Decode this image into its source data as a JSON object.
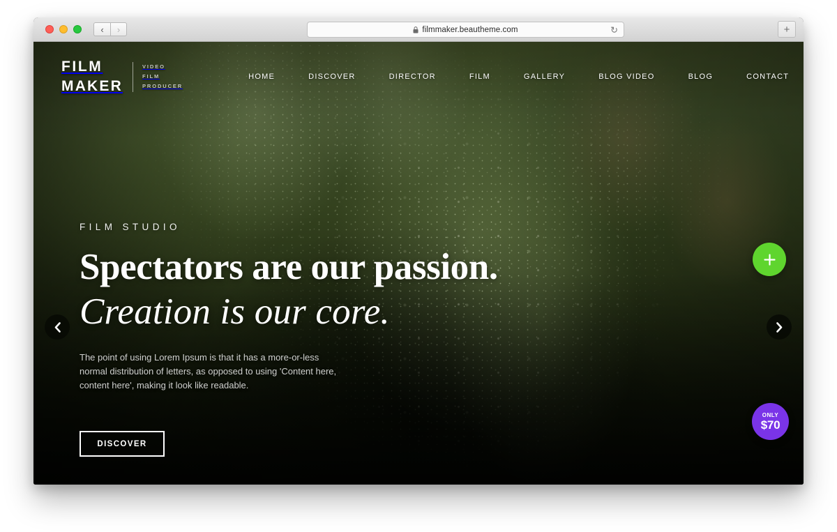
{
  "browser": {
    "traffic_lights": [
      "close",
      "minimize",
      "maximize"
    ],
    "back_label": "‹",
    "forward_label": "›",
    "url": "filmmaker.beautheme.com",
    "lock_icon": "lock-icon",
    "reload_icon": "↻",
    "newtab_label": "+"
  },
  "site": {
    "logo": {
      "line1": "FILM",
      "line2": "MAKER",
      "tagline_line1": "VIDEO",
      "tagline_line2": "FILM",
      "tagline_line3": "PRODUCER"
    },
    "nav": [
      {
        "label": "HOME"
      },
      {
        "label": "DISCOVER"
      },
      {
        "label": "DIRECTOR"
      },
      {
        "label": "FILM"
      },
      {
        "label": "GALLERY"
      },
      {
        "label": "BLOG VIDEO"
      },
      {
        "label": "BLOG"
      },
      {
        "label": "CONTACT"
      }
    ],
    "search_icon": "search-icon"
  },
  "hero": {
    "eyebrow": "FILM STUDIO",
    "title_line1": "Spectators are our passion.",
    "title_line2": "Creation is our core.",
    "paragraph": "The point of using Lorem Ipsum is that it has a more-or-less normal distribution of letters, as opposed to using 'Content here, content here', making it look like readable.",
    "cta_label": "DISCOVER",
    "prev_arrow": "‹",
    "next_arrow": "›"
  },
  "floating": {
    "add_icon": "+",
    "price_prefix": "ONLY",
    "price_amount": "$70"
  },
  "colors": {
    "accent_green": "#5fd52e",
    "accent_purple": "#7a34e8",
    "hero_text": "#ffffff",
    "traffic_close": "#ff5f57",
    "traffic_min": "#ffbd2e",
    "traffic_max": "#28c840"
  }
}
